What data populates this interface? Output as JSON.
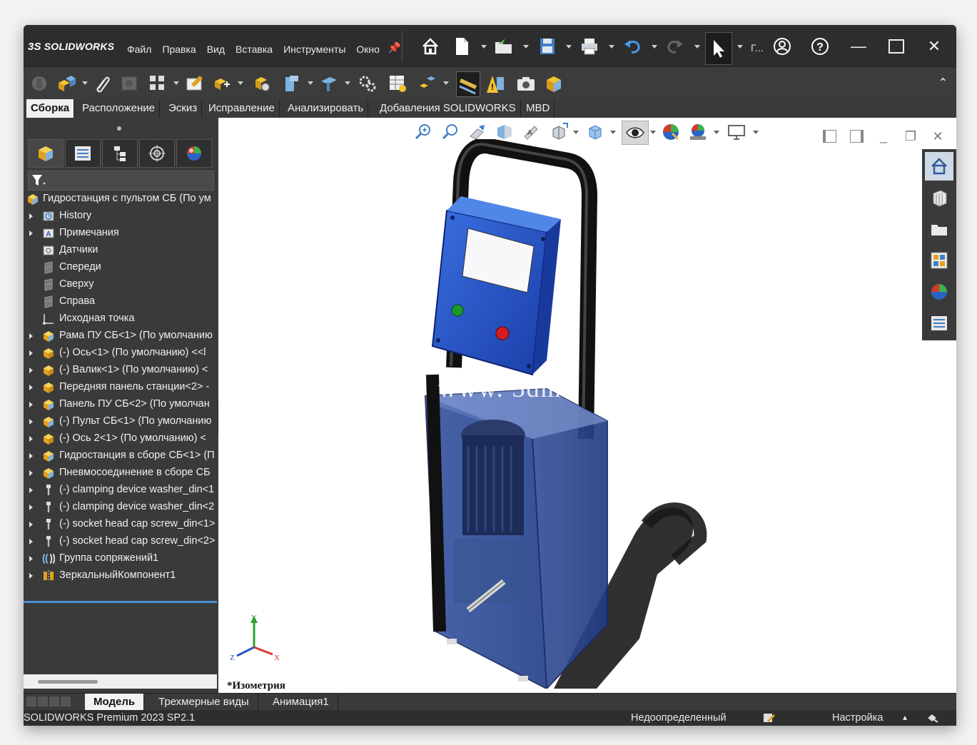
{
  "app": {
    "logo_mark": "3S",
    "logo_text": "SOLIDWORKS",
    "menu": [
      "Файл",
      "Правка",
      "Вид",
      "Вставка",
      "Инструменты",
      "Окно"
    ],
    "truncated_label": "Г..."
  },
  "command_tabs": [
    "Сборка",
    "Расположение",
    "Эскиз",
    "Исправление",
    "Анализировать",
    "Добавления SOLIDWORKS",
    "MBD"
  ],
  "active_tab": "Сборка",
  "feature_tree": {
    "root": "Гидростанция с пультом СБ (По ум",
    "items": [
      {
        "label": "History",
        "expandable": true,
        "icon": "history-icon"
      },
      {
        "label": "Примечания",
        "expandable": true,
        "icon": "annotations-icon"
      },
      {
        "label": "Датчики",
        "expandable": false,
        "icon": "sensors-icon"
      },
      {
        "label": "Спереди",
        "expandable": false,
        "icon": "plane-icon"
      },
      {
        "label": "Сверху",
        "expandable": false,
        "icon": "plane-icon"
      },
      {
        "label": "Справа",
        "expandable": false,
        "icon": "plane-icon"
      },
      {
        "label": "Исходная точка",
        "expandable": false,
        "icon": "origin-icon"
      },
      {
        "label": "Рама ПУ СБ<1> (По умолчанию",
        "expandable": true,
        "icon": "assembly-icon"
      },
      {
        "label": "(-) Ось<1> (По умолчанию) <<l",
        "expandable": true,
        "icon": "part-icon"
      },
      {
        "label": "(-) Валик<1> (По умолчанию) <",
        "expandable": true,
        "icon": "part-icon"
      },
      {
        "label": "Передняя панель станции<2> -",
        "expandable": true,
        "icon": "part-icon"
      },
      {
        "label": "Панель ПУ СБ<2> (По умолчан",
        "expandable": true,
        "icon": "assembly-icon"
      },
      {
        "label": "(-) Пульт СБ<1> (По умолчанию",
        "expandable": true,
        "icon": "assembly-icon"
      },
      {
        "label": "(-) Ось 2<1> (По умолчанию) <",
        "expandable": true,
        "icon": "part-icon"
      },
      {
        "label": "Гидростанция в сборе СБ<1> (П",
        "expandable": true,
        "icon": "assembly-icon"
      },
      {
        "label": "Пневмосоединение в сборе СБ",
        "expandable": true,
        "icon": "assembly-icon"
      },
      {
        "label": "(-) clamping device washer_din<1",
        "expandable": true,
        "icon": "toolbox-icon"
      },
      {
        "label": "(-) clamping device washer_din<2",
        "expandable": true,
        "icon": "toolbox-icon"
      },
      {
        "label": "(-) socket head cap screw_din<1>",
        "expandable": true,
        "icon": "toolbox-icon"
      },
      {
        "label": "(-) socket head cap screw_din<2>",
        "expandable": true,
        "icon": "toolbox-icon"
      },
      {
        "label": "Группа сопряжений1",
        "expandable": true,
        "icon": "mates-icon"
      },
      {
        "label": "ЗеркальныйКомпонент1",
        "expandable": true,
        "icon": "mirror-component-icon"
      }
    ]
  },
  "viewport": {
    "view_name": "*Изометрия",
    "watermark": "www. 3dmo",
    "triad": {
      "x": "X",
      "y": "Y",
      "z": "Z"
    }
  },
  "bottom_tabs": [
    "Модель",
    "Трехмерные виды",
    "Анимация1"
  ],
  "status": {
    "version": "SOLIDWORKS Premium 2023 SP2.1",
    "state": "Недоопределенный",
    "custom": "Настройка",
    "caret": "▴"
  }
}
